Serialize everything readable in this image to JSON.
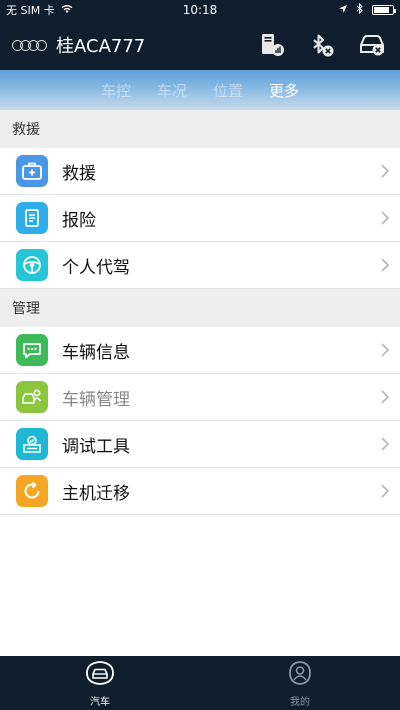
{
  "status_bar": {
    "carrier": "无 SIM 卡",
    "time": "10:18",
    "battery_level": 0.85
  },
  "header": {
    "title": "桂ACA777",
    "icons": [
      "audi-logo",
      "device-stats-icon",
      "bluetooth-disconnected-icon",
      "car-disconnected-icon"
    ]
  },
  "tabs": [
    {
      "label": "车控",
      "active": false
    },
    {
      "label": "车况",
      "active": false
    },
    {
      "label": "位置",
      "active": false
    },
    {
      "label": "更多",
      "active": true
    }
  ],
  "sections": [
    {
      "title": "救援",
      "items": [
        {
          "label": "救援",
          "icon": "first-aid-kit-icon",
          "color": "#4a97e8"
        },
        {
          "label": "报险",
          "icon": "document-icon",
          "color": "#2eaee8"
        },
        {
          "label": "个人代驾",
          "icon": "steering-wheel-icon",
          "color": "#25c6d6"
        }
      ]
    },
    {
      "title": "管理",
      "items": [
        {
          "label": "车辆信息",
          "icon": "message-icon",
          "color": "#3fba5a"
        },
        {
          "label": "车辆管理",
          "icon": "car-person-icon",
          "color": "#8cc63f",
          "muted": true
        },
        {
          "label": "调试工具",
          "icon": "debug-tool-icon",
          "color": "#1fb8d4"
        },
        {
          "label": "主机迁移",
          "icon": "migrate-icon",
          "color": "#f5a623"
        }
      ]
    }
  ],
  "bottom_nav": [
    {
      "label": "汽车",
      "icon": "car-icon",
      "active": true
    },
    {
      "label": "我的",
      "icon": "user-icon",
      "active": false
    }
  ]
}
